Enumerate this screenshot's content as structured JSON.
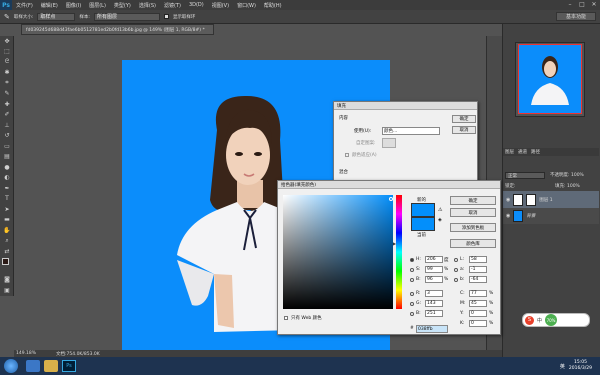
{
  "app": {
    "logo": "Ps"
  },
  "menu": [
    "文件(F)",
    "编辑(E)",
    "图像(I)",
    "图层(L)",
    "类型(Y)",
    "选择(S)",
    "滤镜(T)",
    "3D(D)",
    "视图(V)",
    "窗口(W)",
    "帮助(H)"
  ],
  "window_controls": [
    "–",
    "□",
    "✕"
  ],
  "options": {
    "brush_size_label": "取样大小:",
    "brush_size_value": "取样点",
    "sample_label": "样本:",
    "sample_value": "所有图层",
    "show_ring": "显示取样环"
  },
  "essentials": "基本功能",
  "doc_tab": "fd039245d688d43fae6b0512781ed2b0fd13b6b.jpg @ 149% (图层 1, RGB/8#) *",
  "status": {
    "zoom": "149.18%",
    "doc": "文档:754.0K/853.0K"
  },
  "panels": {
    "tab1": "图层",
    "tab2": "通道",
    "tab3": "路径",
    "kind": "正常",
    "opacity_label": "不透明度:",
    "opacity": "100%",
    "lock_label": "锁定:",
    "fill_label": "填充:",
    "fill": "100%",
    "layer1": "图层 1",
    "bg": "背景"
  },
  "fill_dialog": {
    "title": "填充",
    "content_label": "内容",
    "use_label": "使用(U):",
    "use_value": "颜色...",
    "custom_pattern": "自定图案:",
    "color_adapt": "颜色适应(A)",
    "blend_label": "混合",
    "ok": "确定",
    "cancel": "取消"
  },
  "picker": {
    "title": "拾色器(填充颜色)",
    "new_label": "新的",
    "current_label": "当前",
    "ok": "确定",
    "cancel": "取消",
    "add_swatch": "添加到色板",
    "color_lib": "颜色库",
    "web_only": "只有 Web 颜色",
    "H": "206",
    "S": "99",
    "B": "96",
    "R": "3",
    "G": "143",
    "Bv": "251",
    "L": "58",
    "a": "-1",
    "b": "-64",
    "C": "77",
    "M": "45",
    "Y": "0",
    "K": "0",
    "deg": "度",
    "pct": "%",
    "hex": "038ffb",
    "labels": {
      "H": "H:",
      "S": "S:",
      "B": "B:",
      "R": "R:",
      "G": "G:",
      "Bb": "B:",
      "L": "L:",
      "a": "a:",
      "b": "b:",
      "C": "C:",
      "M": "M:",
      "Y": "Y:",
      "K": "K:"
    },
    "new_color": "#038ffb",
    "current_color": "#038ffb"
  },
  "taskbar": {
    "time": "15:05",
    "date": "2016/3/29",
    "lang": "英",
    "ime_lang": "中",
    "net_pct": "70%"
  },
  "colors": {
    "canvas": "#0b8dfb",
    "ps_blue": "#36a9e1"
  }
}
